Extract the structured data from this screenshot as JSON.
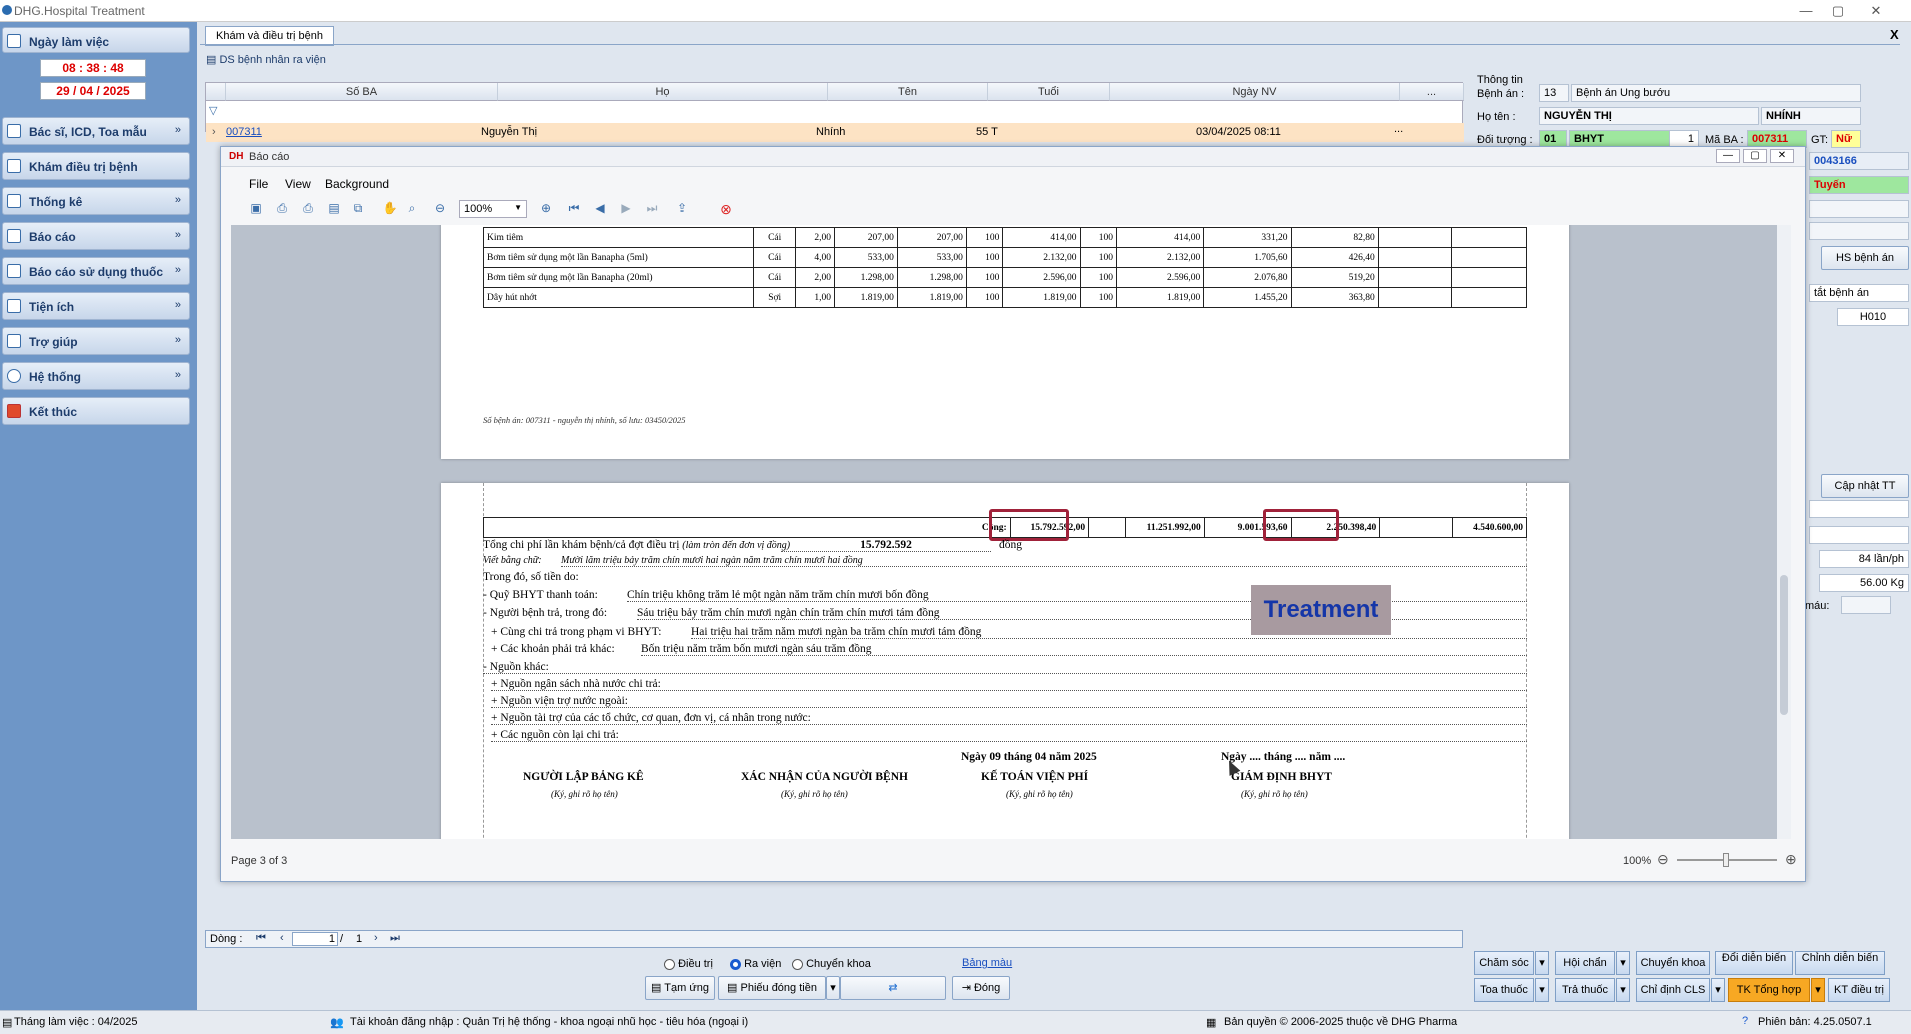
{
  "app": {
    "title": "DHG.Hospital Treatment",
    "min": "—",
    "max": "▢",
    "close": "✕"
  },
  "sidebar": {
    "date_label": "Ngày làm việc",
    "time": "08 : 38 : 48",
    "date": "29 / 04 / 2025",
    "items": [
      {
        "label": "Bác sĩ, ICD, Toa mẫu",
        "chev": "»"
      },
      {
        "label": "Khám điều trị bệnh",
        "chev": ""
      },
      {
        "label": "Thống kê",
        "chev": "»"
      },
      {
        "label": "Báo cáo",
        "chev": "»"
      },
      {
        "label": "Báo cáo sử dụng thuốc",
        "chev": "»"
      },
      {
        "label": "Tiện ích",
        "chev": "»"
      },
      {
        "label": "Trợ giúp",
        "chev": "»"
      },
      {
        "label": "Hệ thống",
        "chev": "»"
      },
      {
        "label": "Kết thúc",
        "chev": ""
      }
    ]
  },
  "main": {
    "tab": "Khám và điều trị bệnh",
    "subtab": "DS bệnh nhân ra viện",
    "close": "X"
  },
  "grid": {
    "columns": [
      "Số BA",
      "Họ",
      "Tên",
      "Tuổi",
      "Ngày NV",
      "..."
    ],
    "row": {
      "soba": "007311",
      "ho": "Nguyễn Thị",
      "ten": "Nhính",
      "tuoi": "55 T",
      "ngaynv": "03/04/2025 08:11",
      "more": "..."
    },
    "pager": {
      "label": "Dòng :",
      "current": "1",
      "sep": "/",
      "total": "1"
    }
  },
  "info": {
    "title": "Thông tin",
    "benhan_label": "Bệnh án :",
    "benhan_no": "13",
    "benhan_name": "Bệnh án Ung bướu",
    "hoten_label": "Họ tên :",
    "hoten": "NGUYỄN THỊ",
    "ten": "NHÍNH",
    "doituong_label": "Đối tượng :",
    "doituong_code": "01",
    "doituong": "BHYT",
    "doituong_n": "1",
    "maba_label": "Mã BA :",
    "maba": "007311",
    "gt_label": "GT:",
    "gt": "Nữ",
    "code2": "0043166",
    "tuyen": "Tuyến",
    "hs_benhan": "HS bệnh án",
    "tat_benhan": "tắt bệnh án",
    "h010": "H010",
    "capnhat": "Cập nhật TT",
    "lanph": "84 lần/ph",
    "kg": "56.00 Kg",
    "mau": "máu:"
  },
  "report": {
    "title": "Báo cáo",
    "menu": [
      "File",
      "View",
      "Background"
    ],
    "zoom": "100%",
    "page_info": "Page 3 of 3",
    "zoom_bottom": "100%",
    "rows": [
      {
        "name": "Kim tiêm",
        "unit": "Cái",
        "qty": "2,00",
        "p1": "207,00",
        "p2": "207,00",
        "pct": "100",
        "t1": "414,00",
        "pct2": "100",
        "t2": "414,00",
        "bh": "331,20",
        "bn": "82,80"
      },
      {
        "name": "Bơm tiêm sử dụng một lần Banapha (5ml)",
        "unit": "Cái",
        "qty": "4,00",
        "p1": "533,00",
        "p2": "533,00",
        "pct": "100",
        "t1": "2.132,00",
        "pct2": "100",
        "t2": "2.132,00",
        "bh": "1.705,60",
        "bn": "426,40"
      },
      {
        "name": "Bơm tiêm sử dụng một lần Banapha (20ml)",
        "unit": "Cái",
        "qty": "2,00",
        "p1": "1.298,00",
        "p2": "1.298,00",
        "pct": "100",
        "t1": "2.596,00",
        "pct2": "100",
        "t2": "2.596,00",
        "bh": "2.076,80",
        "bn": "519,20"
      },
      {
        "name": "Dây hút nhớt",
        "unit": "Sợi",
        "qty": "1,00",
        "p1": "1.819,00",
        "p2": "1.819,00",
        "pct": "100",
        "t1": "1.819,00",
        "pct2": "100",
        "t2": "1.819,00",
        "bh": "1.455,20",
        "bn": "363,80"
      }
    ],
    "footer_note": "Số bệnh án: 007311 - nguyễn thị nhính, số lưu: 03450/2025",
    "total": {
      "label": "Cộng:",
      "t1": "15.792.592,00",
      "t2": "11.251.992,00",
      "t3": "9.001.593,60",
      "t4": "2.250.398,40",
      "t5": "4.540.600,00"
    },
    "lines": {
      "tong": "Tổng chi phí lần khám bệnh/cả đợt điều trị",
      "tong_note": "(làm tròn đến đơn vị đồng)",
      "tong_val": "15.792.592",
      "dong": "đồng",
      "vietbangchu_label": "Viết bằng chữ:",
      "vietbangchu": "Mười lăm triệu bảy trăm chín mươi hai ngàn năm trăm chín mươi hai đồng",
      "trongdo": "Trong đó, số tiền do:",
      "quy_label": "- Quỹ BHYT thanh toán:",
      "quy": "Chín triệu không trăm lẻ một ngàn năm trăm chín mươi bốn đồng",
      "nbtra_label": "- Người bệnh trả, trong đó:",
      "nbtra": "Sáu triệu bảy trăm chín mươi ngàn chín trăm chín mươi tám đồng",
      "cungchitra_label": "+ Cùng chi trả trong phạm vi BHYT:",
      "cungchitra": "Hai triệu hai trăm năm mươi ngàn ba trăm chín mươi tám đồng",
      "khoan_label": "+ Các khoản phải trả khác:",
      "khoan": "Bốn triệu năm trăm bốn mươi ngàn sáu trăm đồng",
      "nguonkhac": "- Nguồn khác:",
      "ngansach": "+ Nguồn ngân sách nhà nước chi trả:",
      "vientro": "+ Nguồn viện trợ nước ngoài:",
      "taitro": "+ Nguồn tài trợ của các tổ chức, cơ quan, đơn vị, cá nhân trong nước:",
      "conlai": "+ Các nguồn còn lại chi trả:",
      "ngay": "Ngày 09 tháng 04 năm 2025",
      "ngay2": "Ngày .... tháng .... năm ....",
      "sig1": "NGƯỜI LẬP BẢNG KÊ",
      "sig2": "XÁC NHẬN CỦA NGƯỜI BỆNH",
      "sig3": "KẾ TOÁN VIỆN PHÍ",
      "sig4": "GIÁM ĐỊNH BHYT",
      "kyghi": "(Ký, ghi rõ họ tên)"
    }
  },
  "watermark": "Treatment",
  "bottom": {
    "radio": [
      "Điều trị",
      "Ra viện",
      "Chuyển khoa"
    ],
    "bangmau": "Bảng màu",
    "tamung": "Tạm ứng",
    "phieudongtien": "Phiếu đóng tiền",
    "dong": "Đóng",
    "right_buttons": [
      "Chăm sóc",
      "Hội chẩn",
      "Chuyển khoa",
      "Đổi diễn biến",
      "Chỉnh diễn biến",
      "Toa thuốc",
      "Trả thuốc",
      "Chỉ định CLS",
      "TK Tổng hợp",
      "KT điều trị"
    ]
  },
  "status": {
    "thang": "Tháng làm việc : 04/2025",
    "taikhoan": "Tài khoản đăng nhập : Quản Trị hệ thống - khoa ngoại nhũ học - tiêu hóa (ngoại i)",
    "banquyen": "Bản quyền © 2006-2025 thuộc về DHG Pharma",
    "phienban": "Phiên bản: 4.25.0507.1"
  }
}
